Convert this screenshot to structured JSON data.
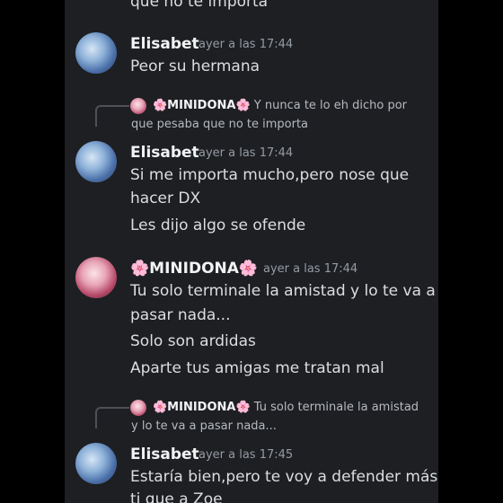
{
  "colors": {
    "background": "#1e1f22",
    "text": "#dbdee1",
    "username": "#f2f3f5",
    "timestamp": "#949ba4",
    "flower": "#f47fa4"
  },
  "messages": {
    "m0": {
      "text": "que no te importa"
    },
    "m1": {
      "author": "Elisabet",
      "time": "ayer a las 17:44",
      "lines": [
        "Peor su hermana"
      ]
    },
    "m2": {
      "reply_author": "🌸MINIDONA🌸",
      "reply_text": "Y nunca te lo eh dicho por que pesaba que no te importa",
      "author": "Elisabet",
      "time": "ayer a las 17:44",
      "lines": [
        "Si me importa mucho,pero nose que",
        "hacer DX",
        "Les dijo  algo se ofende"
      ]
    },
    "m3": {
      "author": "🌸MINIDONA🌸",
      "time": "ayer a las 17:44",
      "lines": [
        "Tu solo terminale la amistad y lo te va a",
        "pasar nada...",
        "Solo son ardidas",
        "Aparte tus amigas me tratan mal"
      ]
    },
    "m4": {
      "reply_author": "🌸MINIDONA🌸",
      "reply_text": "Tu solo terminale la amistad y lo te va a pasar nada...",
      "author": "Elisabet",
      "time": "ayer a las 17:45",
      "lines": [
        "Estaría bien,pero te voy a defender más a",
        "ti que a Zoe"
      ]
    }
  }
}
